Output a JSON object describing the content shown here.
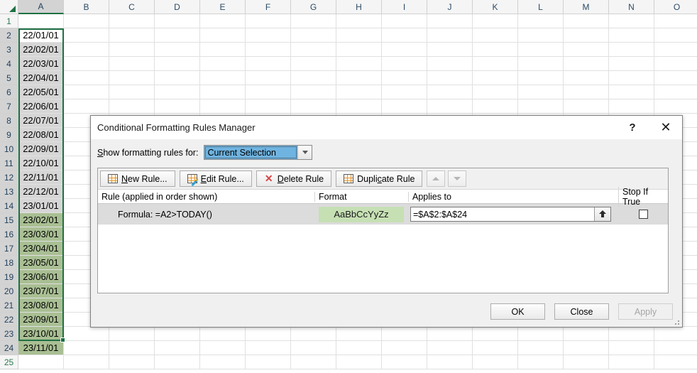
{
  "spreadsheet": {
    "columns": [
      "A",
      "B",
      "C",
      "D",
      "E",
      "F",
      "G",
      "H",
      "I",
      "J",
      "K",
      "L",
      "M",
      "N",
      "O"
    ],
    "selected_column": "A",
    "rows": [
      {
        "num": "1",
        "a": "",
        "state": "empty"
      },
      {
        "num": "2",
        "a": "22/01/01",
        "state": "active"
      },
      {
        "num": "3",
        "a": "22/02/01",
        "state": "selected"
      },
      {
        "num": "4",
        "a": "22/03/01",
        "state": "selected"
      },
      {
        "num": "5",
        "a": "22/04/01",
        "state": "selected"
      },
      {
        "num": "6",
        "a": "22/05/01",
        "state": "selected"
      },
      {
        "num": "7",
        "a": "22/06/01",
        "state": "selected"
      },
      {
        "num": "8",
        "a": "22/07/01",
        "state": "selected"
      },
      {
        "num": "9",
        "a": "22/08/01",
        "state": "selected"
      },
      {
        "num": "10",
        "a": "22/09/01",
        "state": "selected"
      },
      {
        "num": "11",
        "a": "22/10/01",
        "state": "selected"
      },
      {
        "num": "12",
        "a": "22/11/01",
        "state": "selected"
      },
      {
        "num": "13",
        "a": "22/12/01",
        "state": "selected"
      },
      {
        "num": "14",
        "a": "23/01/01",
        "state": "selected"
      },
      {
        "num": "15",
        "a": "23/02/01",
        "state": "formatted"
      },
      {
        "num": "16",
        "a": "23/03/01",
        "state": "formatted"
      },
      {
        "num": "17",
        "a": "23/04/01",
        "state": "formatted"
      },
      {
        "num": "18",
        "a": "23/05/01",
        "state": "formatted"
      },
      {
        "num": "19",
        "a": "23/06/01",
        "state": "formatted"
      },
      {
        "num": "20",
        "a": "23/07/01",
        "state": "formatted"
      },
      {
        "num": "21",
        "a": "23/08/01",
        "state": "formatted"
      },
      {
        "num": "22",
        "a": "23/09/01",
        "state": "formatted"
      },
      {
        "num": "23",
        "a": "23/10/01",
        "state": "formatted"
      },
      {
        "num": "24",
        "a": "23/11/01",
        "state": "formatted"
      },
      {
        "num": "25",
        "a": "",
        "state": "empty"
      }
    ],
    "colors": {
      "selection_border": "#1f7044",
      "selection_fill": "#d6d6d6",
      "conditional_fill": "#a9bf93",
      "header_fill": "#f5f5f5"
    }
  },
  "dialog": {
    "title": "Conditional Formatting Rules Manager",
    "help_glyph": "?",
    "close_glyph": "✕",
    "show_rules_label": "Show formatting rules for:",
    "scope_value": "Current Selection",
    "toolbar": {
      "new_rule": "New Rule...",
      "edit_rule": "Edit Rule...",
      "delete_rule": "Delete Rule",
      "duplicate_rule": "Duplicate Rule"
    },
    "table": {
      "headers": {
        "rule": "Rule (applied in order shown)",
        "format": "Format",
        "applies_to": "Applies to",
        "stop_if_true": "Stop If True"
      },
      "rows": [
        {
          "rule": "Formula: =A2>TODAY()",
          "format_preview": "AaBbCcYyZz",
          "format_color": "#c6e0b4",
          "applies_to": "=$A$2:$A$24",
          "stop_if_true": false
        }
      ]
    },
    "footer": {
      "ok": "OK",
      "close": "Close",
      "apply": "Apply",
      "apply_disabled": true
    }
  }
}
